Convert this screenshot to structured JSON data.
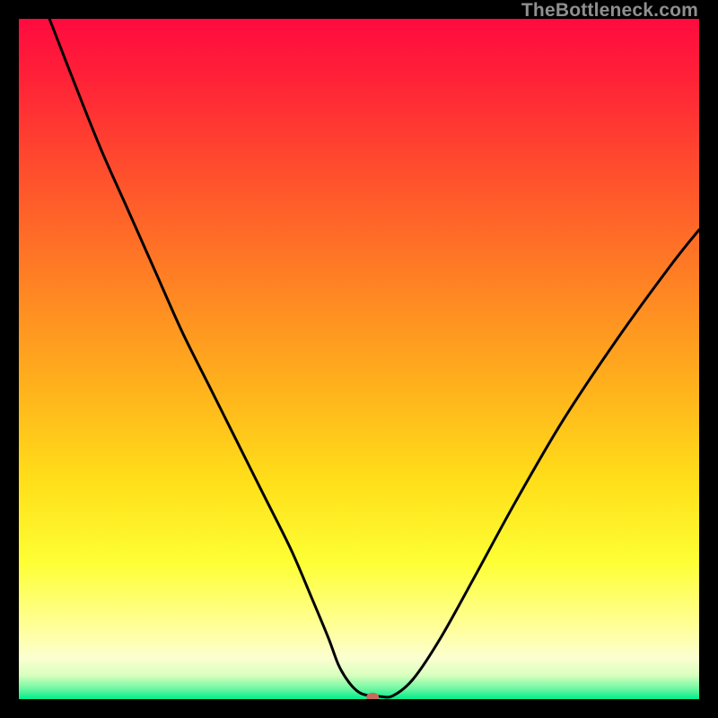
{
  "watermark": {
    "text": "TheBottleneck.com"
  },
  "chart_data": {
    "type": "line",
    "title": "",
    "xlabel": "",
    "ylabel": "",
    "xlim": [
      0,
      100
    ],
    "ylim": [
      0,
      100
    ],
    "gradient_stops": [
      {
        "offset": 0.0,
        "color": "#ff0b3f"
      },
      {
        "offset": 0.08,
        "color": "#ff1f38"
      },
      {
        "offset": 0.18,
        "color": "#ff4030"
      },
      {
        "offset": 0.3,
        "color": "#ff6628"
      },
      {
        "offset": 0.42,
        "color": "#ff8c22"
      },
      {
        "offset": 0.55,
        "color": "#ffb41c"
      },
      {
        "offset": 0.68,
        "color": "#ffdf19"
      },
      {
        "offset": 0.8,
        "color": "#feff35"
      },
      {
        "offset": 0.9,
        "color": "#ffffa0"
      },
      {
        "offset": 0.94,
        "color": "#fbffd0"
      },
      {
        "offset": 0.965,
        "color": "#d8ffbe"
      },
      {
        "offset": 0.985,
        "color": "#6cf7a2"
      },
      {
        "offset": 1.0,
        "color": "#00ec8b"
      }
    ],
    "series": [
      {
        "name": "bottleneck-curve",
        "x": [
          4.5,
          8,
          12,
          16,
          20,
          24,
          28,
          32,
          36,
          40,
          43,
          45.5,
          47,
          48.5,
          50,
          51.5,
          53,
          55,
          58,
          62,
          67,
          73,
          80,
          88,
          96,
          100
        ],
        "y": [
          100,
          91,
          81,
          72,
          63,
          54,
          46,
          38,
          30,
          22,
          15,
          9,
          5,
          2.5,
          1,
          0.5,
          0.4,
          0.5,
          3,
          9,
          18,
          29,
          41,
          53,
          64,
          69
        ]
      }
    ],
    "marker": {
      "x": 52,
      "y": 0.3,
      "color": "#c66b5b",
      "rx": 7,
      "ry": 5
    }
  }
}
